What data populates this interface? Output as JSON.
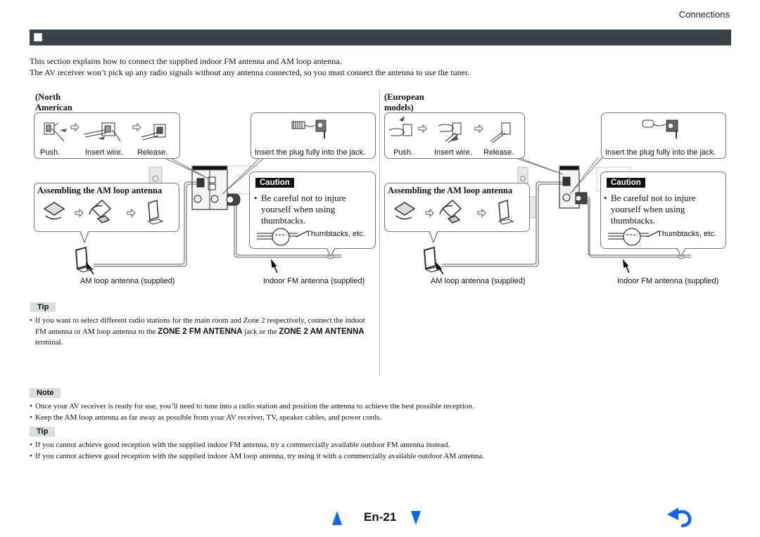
{
  "header": {
    "section": "Connections",
    "title": ""
  },
  "intro": {
    "lines": [
      "This section explains how to connect the supplied indoor FM antenna and AM loop antenna.",
      "The AV receiver won’t pick up any radio signals without any antenna connected, so you must connect the antenna to use the tuner."
    ]
  },
  "regions": [
    {
      "title": "(North American models)",
      "steps": [
        "Push.",
        "Insert wire.",
        "Release."
      ],
      "plug_caption": "Insert the plug fully into the jack.",
      "assembling_title": "Assembling the AM loop antenna",
      "caution": {
        "badge": "Caution",
        "text": "Be careful not to injure yourself when using thumbtacks.",
        "bullet": "•",
        "thumbtacks_label": "Thumbtacks, etc."
      },
      "am_label": "AM loop antenna (supplied)",
      "fm_label": "Indoor FM antenna (supplied)"
    },
    {
      "title": "(European models)",
      "steps": [
        "Push.",
        "Insert wire.",
        "Release."
      ],
      "plug_caption": "Insert the plug fully into the jack.",
      "assembling_title": "Assembling the AM loop antenna",
      "caution": {
        "badge": "Caution",
        "text": "Be careful not to injure yourself when using thumbtacks.",
        "bullet": "•",
        "thumbtacks_label": "Thumbtacks, etc."
      },
      "am_label": "AM loop antenna (supplied)",
      "fm_label": "Indoor FM antenna (supplied)"
    }
  ],
  "tip1": {
    "badge": "Tip",
    "text_pre": "If you want to select different radio stations for the main room and Zone 2 respectively, connect the indoor FM antenna or AM loop antenna to the ",
    "bold1": "ZONE 2 FM ANTENNA",
    "text_mid": " jack or the ",
    "bold2": "ZONE 2 AM ANTENNA",
    "text_post": " terminal."
  },
  "note": {
    "badge": "Note",
    "items": [
      "Once your AV receiver is ready for use, you’ll need to tune into a radio station and position the antenna to achieve the best possible reception.",
      "Keep the AM loop antenna as far away as possible from your AV receiver, TV, speaker cables, and power cords."
    ]
  },
  "tip2": {
    "badge": "Tip",
    "items": [
      "If you cannot achieve good reception with the supplied indoor FM antenna, try a commercially available outdoor FM antenna instead.",
      "If you cannot achieve good reception with the supplied indoor AM loop antenna, try using it with a commercially available outdoor AM antenna."
    ]
  },
  "footer": {
    "page": "En-21",
    "prev_icon": "triangle-up-icon",
    "next_icon": "triangle-down-icon",
    "back_icon": "return-arrow-icon",
    "accent": "#0a66ff"
  }
}
